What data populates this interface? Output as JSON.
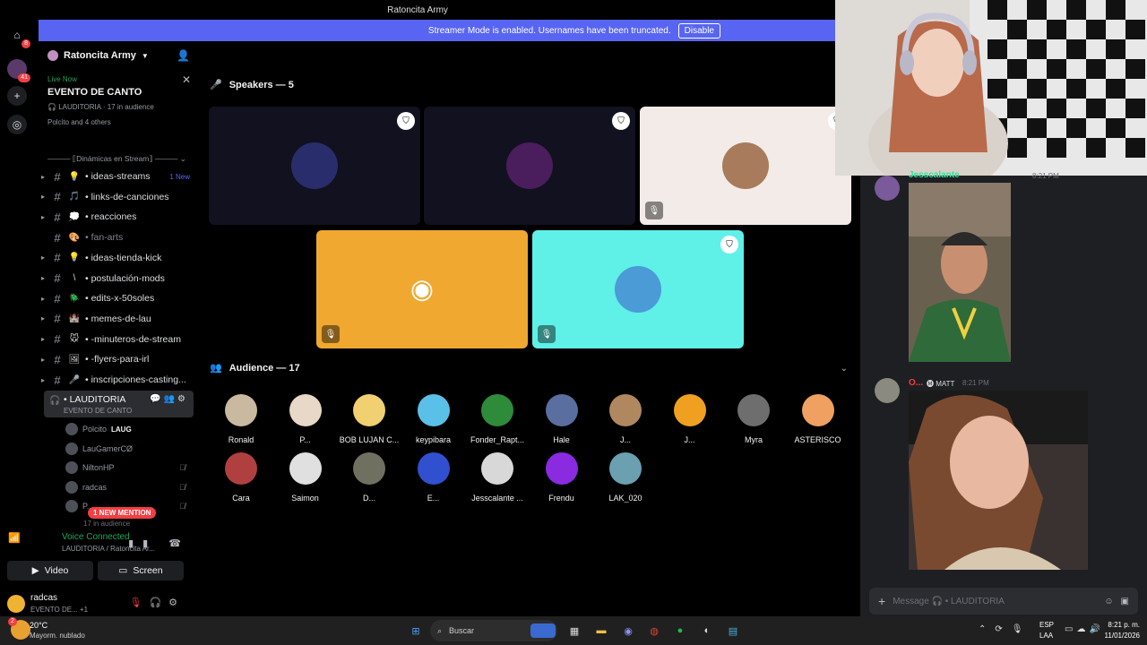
{
  "titlebar": {
    "title": "Ratoncita Army"
  },
  "banner": {
    "text": "Streamer Mode is enabled. Usernames have been truncated.",
    "button": "Disable"
  },
  "rail": {
    "home_badge": "8",
    "server_badge": "41"
  },
  "server": {
    "name": "Ratoncita Army"
  },
  "live": {
    "status": "Live Now",
    "event": "EVENTO DE CANTO",
    "channel": "LAUDITORIA",
    "audience": "17 in audience",
    "speakers": "Polcito and 4 others"
  },
  "category": "Dinámicas en Stream",
  "channels": [
    {
      "name": "ideas-streams",
      "emoji": "💡",
      "badge": "1 New",
      "muted": false
    },
    {
      "name": "links-de-canciones",
      "emoji": "🎵",
      "badge": "",
      "muted": false
    },
    {
      "name": "reacciones",
      "emoji": "💭",
      "badge": "",
      "muted": false
    },
    {
      "name": "fan-arts",
      "emoji": "🎨",
      "badge": "",
      "muted": true
    },
    {
      "name": "ideas-tienda-kick",
      "emoji": "💡",
      "badge": "",
      "muted": false
    },
    {
      "name": "postulación-mods",
      "emoji": "\\",
      "badge": "",
      "muted": false
    },
    {
      "name": "edits-x-50soles",
      "emoji": "🪲",
      "badge": "",
      "muted": false
    },
    {
      "name": "memes-de-lau",
      "emoji": "🏰",
      "badge": "",
      "muted": false
    },
    {
      "name": "-minuteros-de-stream",
      "emoji": "🐭",
      "badge": "",
      "muted": false
    },
    {
      "name": "-flyers-para-irl",
      "emoji": "🖼",
      "badge": "",
      "muted": false
    },
    {
      "name": "inscripciones-casting...",
      "emoji": "🎤",
      "badge": "",
      "muted": false
    }
  ],
  "voice_channel": {
    "name": "LAUDITORIA",
    "sub": "EVENTO DE CANTO"
  },
  "voice_users": [
    {
      "name": "Polcito",
      "tag": "LAUG"
    },
    {
      "name": "LauGamerCØ",
      "tag": ""
    },
    {
      "name": "NiltonHP",
      "tag": ""
    },
    {
      "name": "radcas",
      "tag": ""
    },
    {
      "name": "P...",
      "tag": ""
    }
  ],
  "audience_hidden": "17 in audience",
  "mention": "1 NEW MENTION",
  "voice_connected": {
    "status": "Voice Connected",
    "location": "LAUDITORIA / Ratoncita Ar...",
    "video": "Video",
    "screen": "Screen"
  },
  "user": {
    "name": "radcas",
    "status": "EVENTO DE...",
    "extra": "+1"
  },
  "stage": {
    "speakers_label": "Speakers — 5",
    "audience_label": "Audience — 17"
  },
  "speakers": [
    {
      "bg": "#11111f",
      "avatar": "#2a2d6b",
      "mod": true,
      "muted": false
    },
    {
      "bg": "#11111f",
      "avatar": "#4a1d5c",
      "mod": true,
      "muted": false
    },
    {
      "bg": "#f3ebe7",
      "avatar": "#a77b5c",
      "mod": true,
      "muted": true
    },
    {
      "bg": "#f0a830",
      "avatar": "#f0a830",
      "mod": false,
      "muted": true
    },
    {
      "bg": "#5ff0e8",
      "avatar": "#4b9bd6",
      "mod": true,
      "muted": true
    }
  ],
  "audience": [
    {
      "name": "Ronald",
      "color": "#c8b9a0"
    },
    {
      "name": "P...",
      "color": "#e8d8c8"
    },
    {
      "name": "BOB LUJAN C...",
      "color": "#f0d070"
    },
    {
      "name": "keypibara",
      "color": "#5bc0e8"
    },
    {
      "name": "Fonder_Rapt...",
      "color": "#2e8b3a"
    },
    {
      "name": "Hale",
      "color": "#5a6ea0"
    },
    {
      "name": "J...",
      "color": "#b08860"
    },
    {
      "name": "J...",
      "color": "#f0a020"
    },
    {
      "name": "Myra",
      "color": "#6e6e6e"
    },
    {
      "name": "ASTERISCO",
      "color": "#f0a060"
    },
    {
      "name": "Cara",
      "color": "#b04040"
    },
    {
      "name": "Saimon",
      "color": "#e0e0e0"
    },
    {
      "name": "D...",
      "color": "#707060"
    },
    {
      "name": "E...",
      "color": "#3050d0"
    },
    {
      "name": "Jesscalante ...",
      "color": "#d8d8d8"
    },
    {
      "name": "Frendu",
      "color": "#8a2be2"
    },
    {
      "name": "LAK_020",
      "color": "#6aa0b0"
    }
  ],
  "chat": {
    "msg1_author": "Jesscalante",
    "msg1_time": "8:21 PM",
    "msg2_author": "O...",
    "msg2_tag": "MATT",
    "msg2_time": "8:21 PM",
    "placeholder": "Message 🎧 • LAUDITORIA"
  },
  "taskbar": {
    "weather_temp": "20°C",
    "weather_desc": "Mayorm. nublado",
    "weather_badge": "2",
    "search": "Buscar",
    "lang1": "ESP",
    "lang2": "LAA",
    "time": "8:21 p. m.",
    "date": "11/01/2026"
  }
}
